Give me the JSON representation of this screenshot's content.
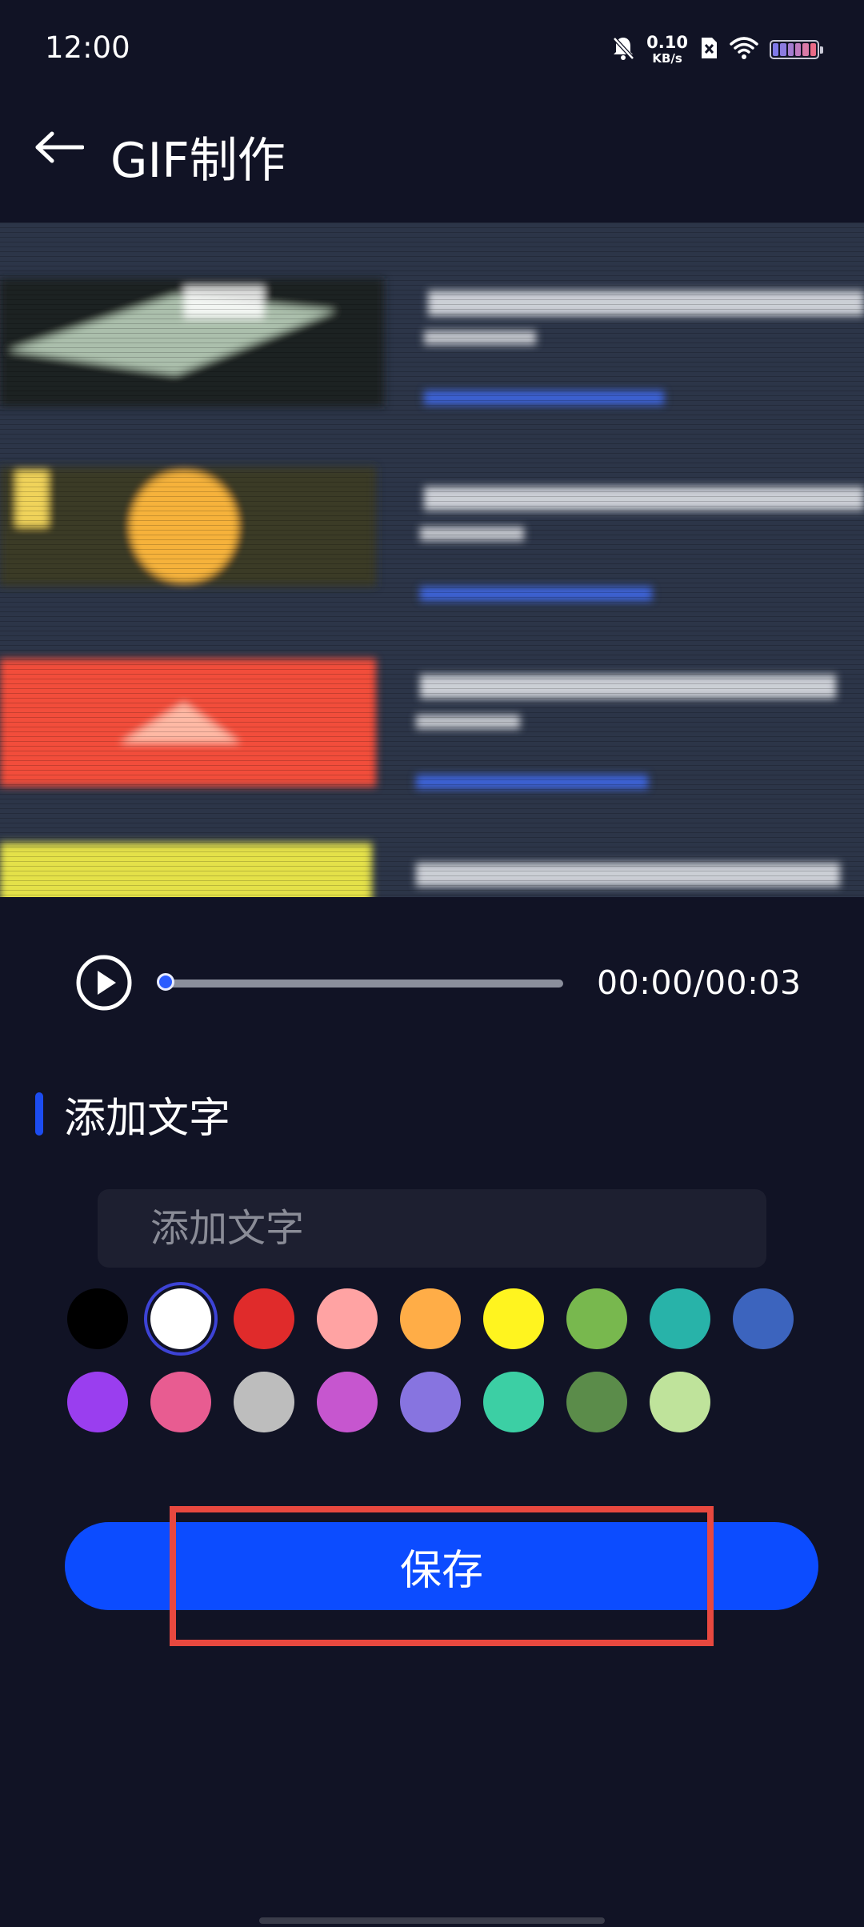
{
  "status_bar": {
    "time": "12:00",
    "net_speed_value": "0.10",
    "net_speed_unit": "KB/s",
    "icons": [
      "bell-muted-icon",
      "sim-x-icon",
      "wifi-icon",
      "battery-icon"
    ]
  },
  "header": {
    "back_icon": "arrow-left-icon",
    "title": "GIF制作"
  },
  "preview": {
    "description_icon": "video-preview"
  },
  "player": {
    "play_icon": "play-circle-icon",
    "progress": 0.0,
    "time": "00:00/00:03"
  },
  "text_section": {
    "title": "添加文字",
    "input_placeholder": "添加文字",
    "input_value": ""
  },
  "colors": [
    {
      "name": "black",
      "hex": "#000000",
      "selected": false
    },
    {
      "name": "white",
      "hex": "#ffffff",
      "selected": true
    },
    {
      "name": "red",
      "hex": "#e02b2b",
      "selected": false
    },
    {
      "name": "pink",
      "hex": "#ffa3a3",
      "selected": false
    },
    {
      "name": "orange",
      "hex": "#ffad47",
      "selected": false
    },
    {
      "name": "yellow",
      "hex": "#fff41f",
      "selected": false
    },
    {
      "name": "green",
      "hex": "#78b84e",
      "selected": false
    },
    {
      "name": "teal",
      "hex": "#28b3a9",
      "selected": false
    },
    {
      "name": "blue",
      "hex": "#3c64be",
      "selected": false
    },
    {
      "name": "purple",
      "hex": "#9a3eef",
      "selected": false
    },
    {
      "name": "rose",
      "hex": "#e85c91",
      "selected": false
    },
    {
      "name": "gray",
      "hex": "#bdbdbd",
      "selected": false
    },
    {
      "name": "magenta",
      "hex": "#c656cf",
      "selected": false
    },
    {
      "name": "lavender",
      "hex": "#8774e0",
      "selected": false
    },
    {
      "name": "mint",
      "hex": "#3ccfa4",
      "selected": false
    },
    {
      "name": "dark-green",
      "hex": "#5b8c4a",
      "selected": false
    },
    {
      "name": "light-green",
      "hex": "#bfe39b",
      "selected": false
    }
  ],
  "actions": {
    "save_label": "保存"
  },
  "theme": {
    "background": "#111325",
    "accent": "#0c4cff",
    "highlight": "#e8483f"
  }
}
